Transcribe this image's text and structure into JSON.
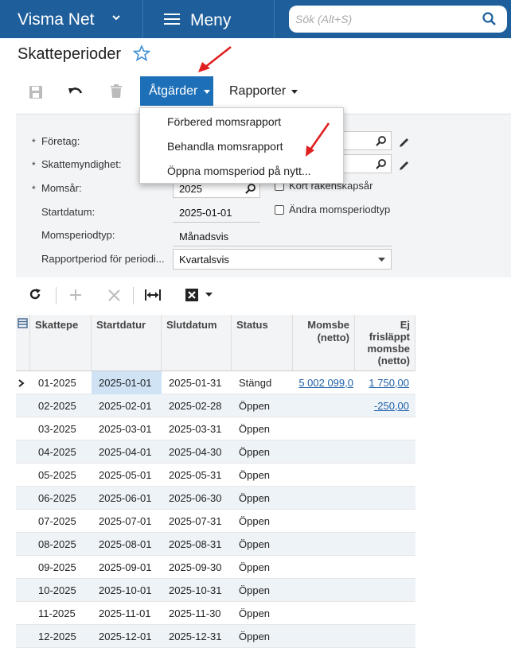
{
  "header": {
    "app_name": "Visma Net",
    "menu_label": "Meny",
    "search_placeholder": "Sök (Alt+S)"
  },
  "page": {
    "title": "Skatteperioder"
  },
  "toolbar": {
    "actions_label": "Åtgärder",
    "reports_label": "Rapporter"
  },
  "actions_menu": {
    "items": [
      "Förbered momsrapport",
      "Behandla momsrapport",
      "Öppna momsperiod på nytt..."
    ]
  },
  "form": {
    "company_label": "Företag:",
    "authority_label": "Skattemyndighet:",
    "vat_year_label": "Momsår:",
    "vat_year_value": "2025",
    "start_date_label": "Startdatum:",
    "start_date_value": "2025-01-01",
    "period_type_label": "Momsperiodtyp:",
    "period_type_value": "Månadsvis",
    "report_period_label": "Rapportperiod för periodi...",
    "report_period_value": "Kvartalsvis",
    "short_fiscal_year_label": "Kort räkenskapsår",
    "change_period_type_label": "Ändra momsperiodtyp"
  },
  "grid": {
    "columns": [
      "Skattepe",
      "Startdatur",
      "Slutdatum",
      "Status",
      "Momsbe (netto)",
      "Ej frisläppt momsbe (netto)"
    ],
    "col_momsbe_1": "Momsbe",
    "col_momsbe_2": "(netto)",
    "col_ej_1": "Ej",
    "col_ej_2": "frisläppt",
    "col_ej_3": "momsbe",
    "col_ej_4": "(netto)",
    "rows": [
      {
        "period": "01-2025",
        "start": "2025-01-01",
        "end": "2025-01-31",
        "status": "Stängd",
        "vat": "5 002 099,0",
        "unreleased": "1 750,00"
      },
      {
        "period": "02-2025",
        "start": "2025-02-01",
        "end": "2025-02-28",
        "status": "Öppen",
        "vat": "",
        "unreleased": "-250,00"
      },
      {
        "period": "03-2025",
        "start": "2025-03-01",
        "end": "2025-03-31",
        "status": "Öppen",
        "vat": "",
        "unreleased": ""
      },
      {
        "period": "04-2025",
        "start": "2025-04-01",
        "end": "2025-04-30",
        "status": "Öppen",
        "vat": "",
        "unreleased": ""
      },
      {
        "period": "05-2025",
        "start": "2025-05-01",
        "end": "2025-05-31",
        "status": "Öppen",
        "vat": "",
        "unreleased": ""
      },
      {
        "period": "06-2025",
        "start": "2025-06-01",
        "end": "2025-06-30",
        "status": "Öppen",
        "vat": "",
        "unreleased": ""
      },
      {
        "period": "07-2025",
        "start": "2025-07-01",
        "end": "2025-07-31",
        "status": "Öppen",
        "vat": "",
        "unreleased": ""
      },
      {
        "period": "08-2025",
        "start": "2025-08-01",
        "end": "2025-08-31",
        "status": "Öppen",
        "vat": "",
        "unreleased": ""
      },
      {
        "period": "09-2025",
        "start": "2025-09-01",
        "end": "2025-09-30",
        "status": "Öppen",
        "vat": "",
        "unreleased": ""
      },
      {
        "period": "10-2025",
        "start": "2025-10-01",
        "end": "2025-10-31",
        "status": "Öppen",
        "vat": "",
        "unreleased": ""
      },
      {
        "period": "11-2025",
        "start": "2025-11-01",
        "end": "2025-11-30",
        "status": "Öppen",
        "vat": "",
        "unreleased": ""
      },
      {
        "period": "12-2025",
        "start": "2025-12-01",
        "end": "2025-12-31",
        "status": "Öppen",
        "vat": "",
        "unreleased": ""
      }
    ]
  },
  "colors": {
    "brand": "#1e5f9b",
    "accent": "#1d6fb8",
    "annotation_arrow": "#e02020",
    "selected_cell": "#cfe3f5"
  }
}
